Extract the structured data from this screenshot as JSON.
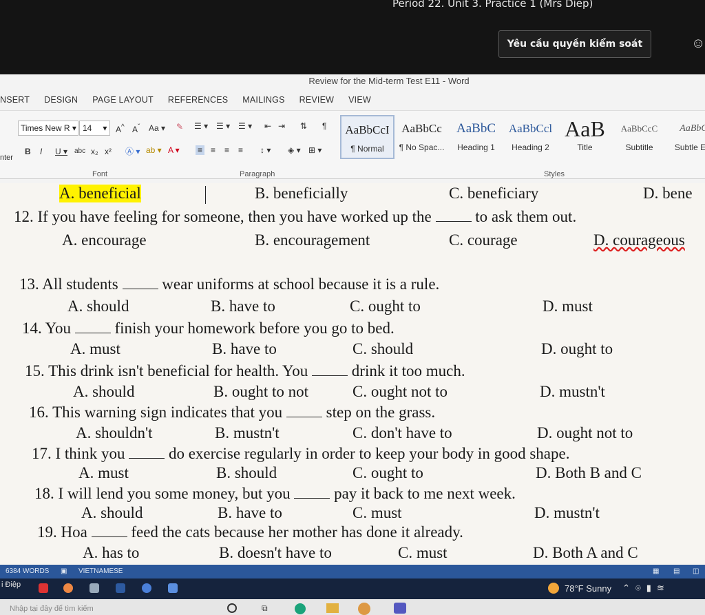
{
  "remote": {
    "session_title": "Period 22. Unit 3. Practice 1 (Mrs Diep)",
    "request_control": "Yêu cầu quyền kiểm soát"
  },
  "word": {
    "title": "Review for the Mid-term Test E11 - Word",
    "tabs": [
      "NSERT",
      "DESIGN",
      "PAGE LAYOUT",
      "REFERENCES",
      "MAILINGS",
      "REVIEW",
      "VIEW"
    ],
    "font_name": "Times New R",
    "font_size": "14",
    "paste_label": "nter",
    "groups": {
      "font": "Font",
      "paragraph": "Paragraph",
      "styles": "Styles"
    },
    "styles": [
      {
        "sample": "AaBbCcI",
        "name": "¶ Normal"
      },
      {
        "sample": "AaBbCc",
        "name": "¶ No Spac..."
      },
      {
        "sample": "AaBbC",
        "name": "Heading 1"
      },
      {
        "sample": "AaBbCcl",
        "name": "Heading 2"
      },
      {
        "sample": "AaB",
        "name": "Title"
      },
      {
        "sample": "AaBbCcC",
        "name": "Subtitle"
      },
      {
        "sample": "AaBbC",
        "name": "Subtle Em"
      }
    ]
  },
  "document": {
    "q11_options": [
      "A. beneficial",
      "B. beneficially",
      "C. beneficiary",
      "D. bene"
    ],
    "q12": {
      "before": "12. If you have feeling for someone, then you have worked up the ",
      "after": " to ask them out.",
      "options": [
        "A. encourage",
        "B. encouragement",
        "C. courage",
        "D. courageous"
      ]
    },
    "q13": {
      "before": "13. All students ",
      "after": " wear uniforms at school because it is a rule.",
      "options": [
        "A. should",
        "B. have to",
        "C. ought to",
        "D. must"
      ]
    },
    "q14": {
      "before": "14. You ",
      "after": " finish your homework before you go to bed.",
      "options": [
        "A. must",
        "B. have to",
        "C. should",
        "D. ought to"
      ]
    },
    "q15": {
      "before": "15. This drink isn't beneficial for health. You ",
      "after": " drink it too much.",
      "options": [
        "A. should",
        "B. ought to not",
        "C. ought not to",
        "D. mustn't"
      ]
    },
    "q16": {
      "before": "16. This warning sign indicates that you ",
      "after": " step on the grass.",
      "options": [
        "A. shouldn't",
        "B. mustn't",
        "C. don't have to",
        "D. ought not to"
      ]
    },
    "q17": {
      "before": "17. I think you ",
      "after": " do exercise regularly in order to keep your body in good shape.",
      "options": [
        "A. must",
        "B. should",
        "C. ought to",
        "D. Both B and C"
      ]
    },
    "q18": {
      "before": "18. I will lend you some money, but you ",
      "after": " pay it back to me next week.",
      "options": [
        "A. should",
        "B. have to",
        "C. must",
        "D. mustn't"
      ]
    },
    "q19": {
      "before": "19. Hoa ",
      "after": " feed the cats because her mother has done it already.",
      "options": [
        "A. has to",
        "B. doesn't have to",
        "C. must",
        "D. Both A and C"
      ]
    }
  },
  "status": {
    "words": "6384 WORDS",
    "language": "VIETNAMESE"
  },
  "taskbar": {
    "user": "i Điệp",
    "weather": "78°F  Sunny",
    "search_placeholder": "Nhập tại đây để tìm kiếm"
  },
  "colors": {
    "ribbon_blue": "#2b579a",
    "highlight": "#fff200",
    "taskbar": "#15233d"
  }
}
